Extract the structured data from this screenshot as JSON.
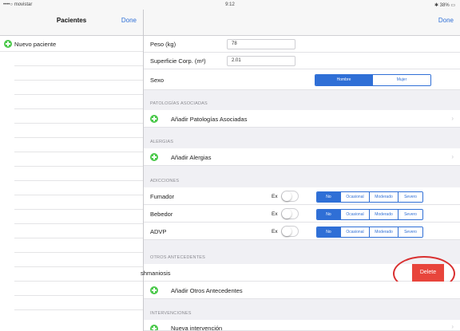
{
  "status_bar": {
    "carrier": "••••○ movistar",
    "time": "9:12",
    "battery": "38%"
  },
  "master": {
    "title": "Pacientes",
    "done_label": "Done",
    "items": [
      {
        "label": "Nuevo paciente"
      }
    ]
  },
  "detail": {
    "done_label": "Done",
    "fields": {
      "peso_label": "Peso (kg)",
      "peso_value": "78",
      "superficie_label": "Superficie Corp. (m²)",
      "superficie_value": "2.01",
      "sexo_label": "Sexo",
      "sexo_options": [
        "Hombre",
        "Mujer"
      ],
      "sexo_selected": "Hombre"
    },
    "sections": {
      "patologias": "PATOLOGÍAS ASOCIADAS",
      "alergias": "ALERGIAS",
      "adicciones": "ADICCIONES",
      "otros": "OTROS ANTECEDENTES",
      "intervenciones": "INTERVENCIONES"
    },
    "add_patologias": "Añadir Patologías Asociadas",
    "add_alergias": "Añadir Alergias",
    "adicciones": [
      {
        "label": "Fumador",
        "ex": "Ex",
        "options": [
          "No",
          "Ocasional",
          "Moderado",
          "Severo"
        ],
        "selected": "No"
      },
      {
        "label": "Bebedor",
        "ex": "Ex",
        "options": [
          "No",
          "Ocasional",
          "Moderado",
          "Severo"
        ],
        "selected": "No"
      },
      {
        "label": "ADVP",
        "ex": "Ex",
        "options": [
          "No",
          "Ocasional",
          "Moderado",
          "Severo"
        ],
        "selected": "No"
      }
    ],
    "otros_item": "shmaniosis",
    "delete_label": "Delete",
    "add_otros": "Añadir Otros Antecedentes",
    "nueva_intervencion": "Nueva intervención"
  },
  "colors": {
    "accent": "#2f6fd6",
    "add_green": "#4cc94c",
    "delete_red": "#e8453c",
    "annotation_red": "#d93030"
  },
  "icons": {
    "add": "plus-circle-icon",
    "chevron": "chevron-right-icon",
    "wifi": "wifi-icon",
    "bluetooth": "bluetooth-icon",
    "battery": "battery-icon"
  }
}
